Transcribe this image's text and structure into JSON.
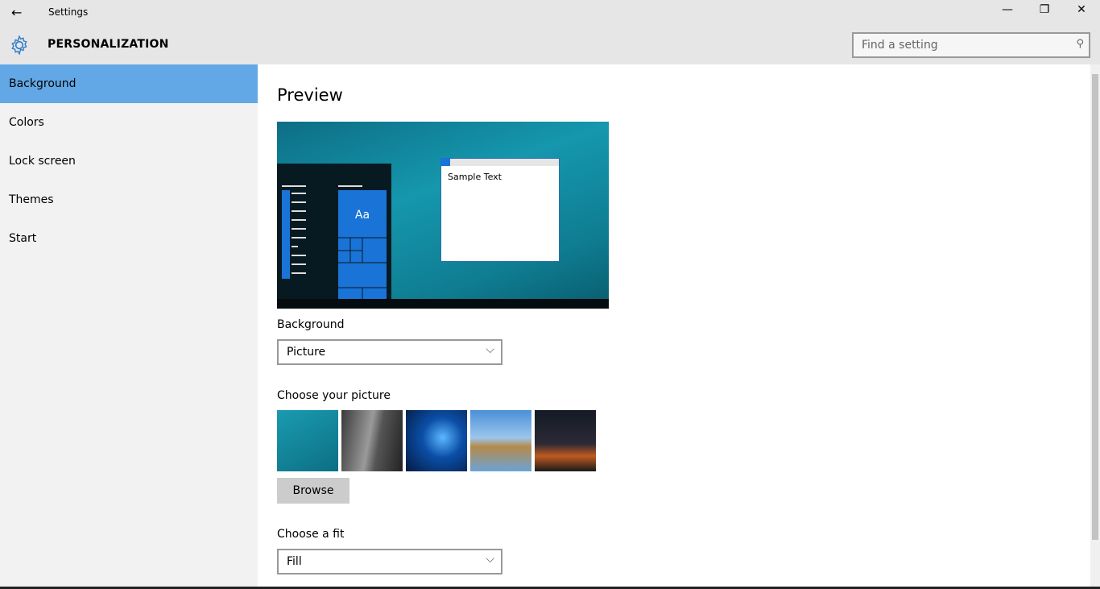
{
  "window": {
    "title": "Settings",
    "back_icon": "back-arrow-icon",
    "minimize": "—",
    "restore": "❐",
    "close": "✕"
  },
  "header": {
    "title": "PERSONALIZATION",
    "search_placeholder": "Find a setting"
  },
  "sidebar": {
    "items": [
      {
        "label": "Background",
        "selected": true
      },
      {
        "label": "Colors"
      },
      {
        "label": "Lock screen"
      },
      {
        "label": "Themes"
      },
      {
        "label": "Start"
      }
    ]
  },
  "main": {
    "preview_title": "Preview",
    "sample_text": "Sample Text",
    "tile_text": "Aa",
    "background_label": "Background",
    "background_value": "Picture",
    "choose_picture_label": "Choose your picture",
    "browse_label": "Browse",
    "fit_label": "Choose a fit",
    "fit_value": "Fill"
  },
  "colors": {
    "accent": "#63a8e6",
    "tile": "#1a73d6"
  }
}
